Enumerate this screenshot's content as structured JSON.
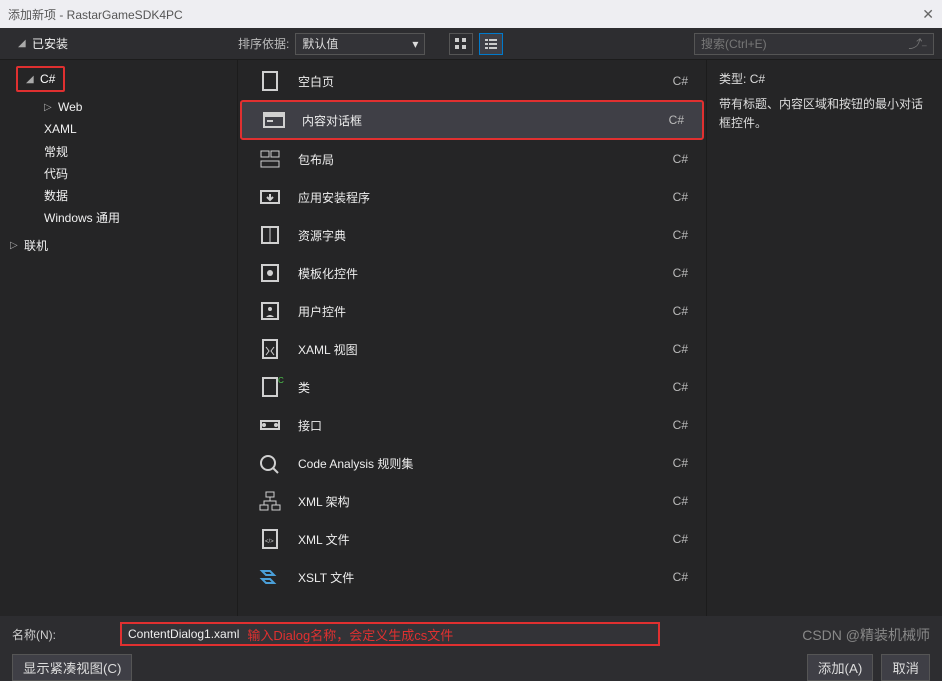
{
  "window": {
    "title": "添加新项 - RastarGameSDK4PC"
  },
  "toolbar": {
    "installed_label": "已安装",
    "sort_label": "排序依据:",
    "sort_value": "默认值",
    "search_placeholder": "搜索(Ctrl+E)"
  },
  "sidebar": {
    "root": "C#",
    "items": [
      "Web",
      "XAML",
      "常规",
      "代码",
      "数据",
      "Windows 通用"
    ],
    "online": "联机"
  },
  "templates": [
    {
      "name": "空白页",
      "lang": "C#",
      "icon": "blank-page"
    },
    {
      "name": "内容对话框",
      "lang": "C#",
      "icon": "content-dialog",
      "selected": true,
      "highlight": true
    },
    {
      "name": "包布局",
      "lang": "C#",
      "icon": "layout"
    },
    {
      "name": "应用安装程序",
      "lang": "C#",
      "icon": "installer"
    },
    {
      "name": "资源字典",
      "lang": "C#",
      "icon": "dictionary"
    },
    {
      "name": "模板化控件",
      "lang": "C#",
      "icon": "templated"
    },
    {
      "name": "用户控件",
      "lang": "C#",
      "icon": "usercontrol"
    },
    {
      "name": "XAML 视图",
      "lang": "C#",
      "icon": "xaml-view"
    },
    {
      "name": "类",
      "lang": "C#",
      "icon": "class"
    },
    {
      "name": "接口",
      "lang": "C#",
      "icon": "interface"
    },
    {
      "name": "Code Analysis 规则集",
      "lang": "C#",
      "icon": "ruleset"
    },
    {
      "name": "XML 架构",
      "lang": "C#",
      "icon": "schema"
    },
    {
      "name": "XML 文件",
      "lang": "C#",
      "icon": "xmlfile"
    },
    {
      "name": "XSLT 文件",
      "lang": "C#",
      "icon": "xslt"
    }
  ],
  "details": {
    "type_label": "类型:",
    "type_value": "C#",
    "description": "带有标题、内容区域和按钮的最小对话框控件。"
  },
  "footer": {
    "name_label": "名称(N):",
    "name_value": "ContentDialog1.xaml",
    "hint": "输入Dialog名称，会定义生成cs文件",
    "compact_btn": "显示紧凑视图(C)",
    "add_btn": "添加(A)",
    "cancel_btn": "取消"
  },
  "watermark": "CSDN @精装机械师"
}
